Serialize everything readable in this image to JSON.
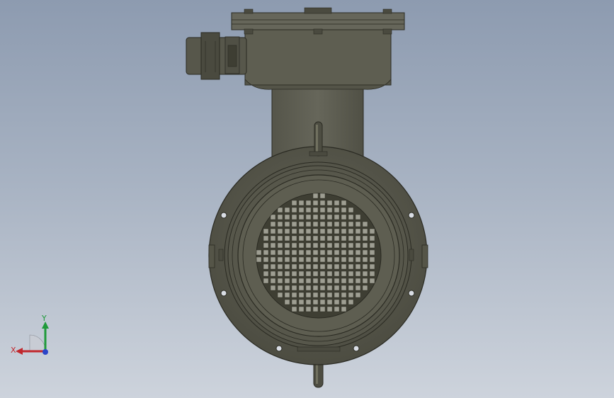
{
  "viewport": {
    "background_top": "#8d9bb0",
    "background_bottom": "#cdd3dc"
  },
  "model": {
    "body_color": "#5a5a4c",
    "body_dark": "#3e3e33",
    "body_light": "#6c6c5c",
    "grille_hole_color": "#9e9e92"
  },
  "triad": {
    "x_label": "X",
    "y_label": "Y",
    "x_color": "#c1272d",
    "y_color": "#1f9a3a",
    "z_color": "#2b45c8"
  }
}
